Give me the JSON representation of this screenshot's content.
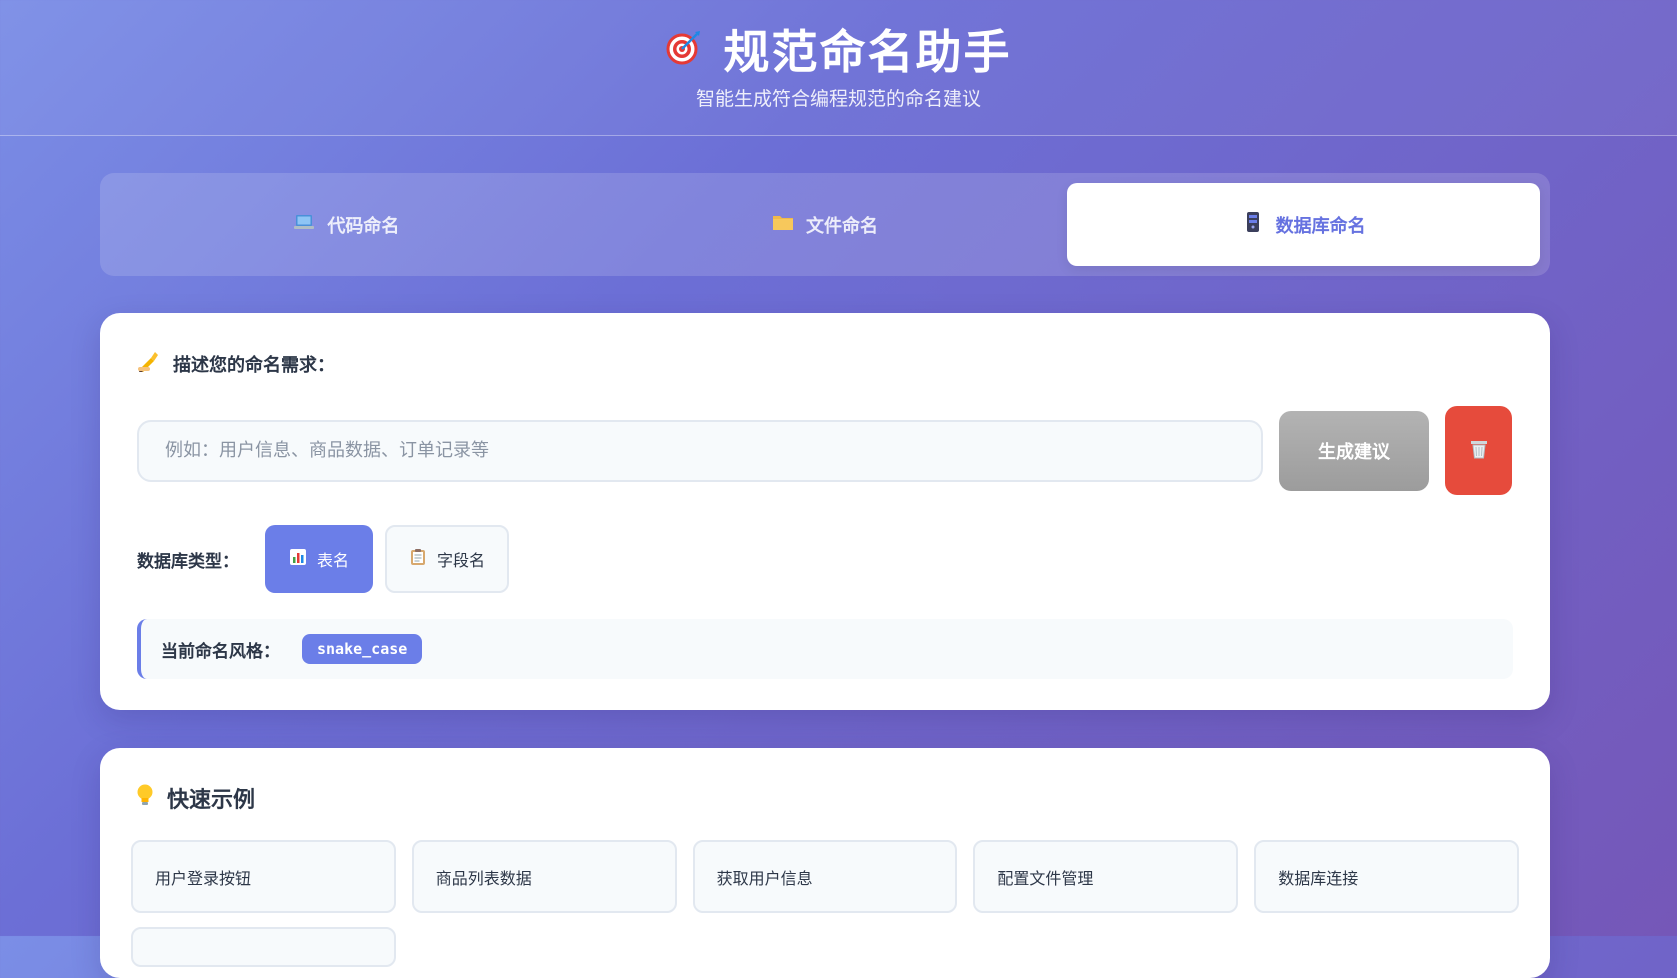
{
  "header": {
    "title": "规范命名助手",
    "subtitle": "智能生成符合编程规范的命名建议",
    "icon": "target-icon"
  },
  "tabs": [
    {
      "label": "代码命名",
      "icon": "laptop-icon",
      "active": false
    },
    {
      "label": "文件命名",
      "icon": "folder-icon",
      "active": false
    },
    {
      "label": "数据库命名",
      "icon": "database-icon",
      "active": true
    }
  ],
  "main": {
    "section_label": "描述您的命名需求：",
    "section_icon": "writing-hand-icon",
    "input_placeholder": "例如：用户信息、商品数据、订单记录等",
    "input_value": "",
    "generate_label": "生成建议",
    "clear_icon": "trash-icon",
    "type_label": "数据库类型：",
    "types": [
      {
        "label": "表名",
        "icon": "chart-icon",
        "active": true
      },
      {
        "label": "字段名",
        "icon": "clipboard-icon",
        "active": false
      }
    ],
    "style_label": "当前命名风格：",
    "style_value": "snake_case"
  },
  "examples": {
    "title": "快速示例",
    "icon": "lightbulb-icon",
    "items": [
      "用户登录按钮",
      "商品列表数据",
      "获取用户信息",
      "配置文件管理",
      "数据库连接",
      ""
    ]
  },
  "colors": {
    "accent": "#6b7ee8",
    "danger": "#e64b3c",
    "disabled_button": "#a8a8a8"
  }
}
